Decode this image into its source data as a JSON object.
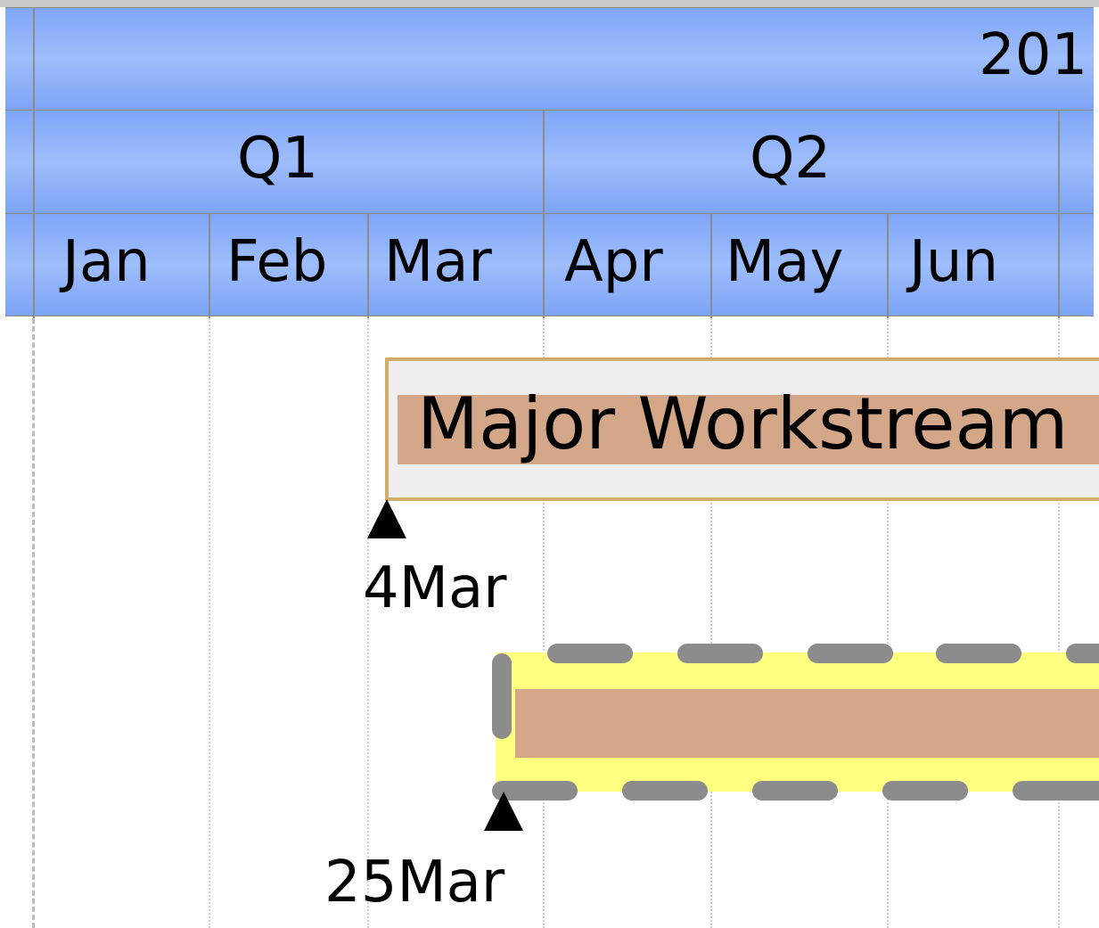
{
  "timeline": {
    "year_label": "201",
    "quarters": [
      "Q1",
      "Q2"
    ],
    "months": [
      "Jan",
      "Feb",
      "Mar",
      "Apr",
      "May",
      "Jun"
    ]
  },
  "tasks": [
    {
      "label": "Major Workstream",
      "start_label": "4Mar",
      "fill_color": "#d4a789",
      "frame_color": "#d0ad6a"
    },
    {
      "label": "",
      "start_label": "25Mar",
      "fill_color": "#d4a789",
      "highlight_color": "#ffff80",
      "border_style": "dashed"
    }
  ],
  "colors": {
    "header": "#8fb2f9",
    "grid": "#cfcfcf"
  }
}
